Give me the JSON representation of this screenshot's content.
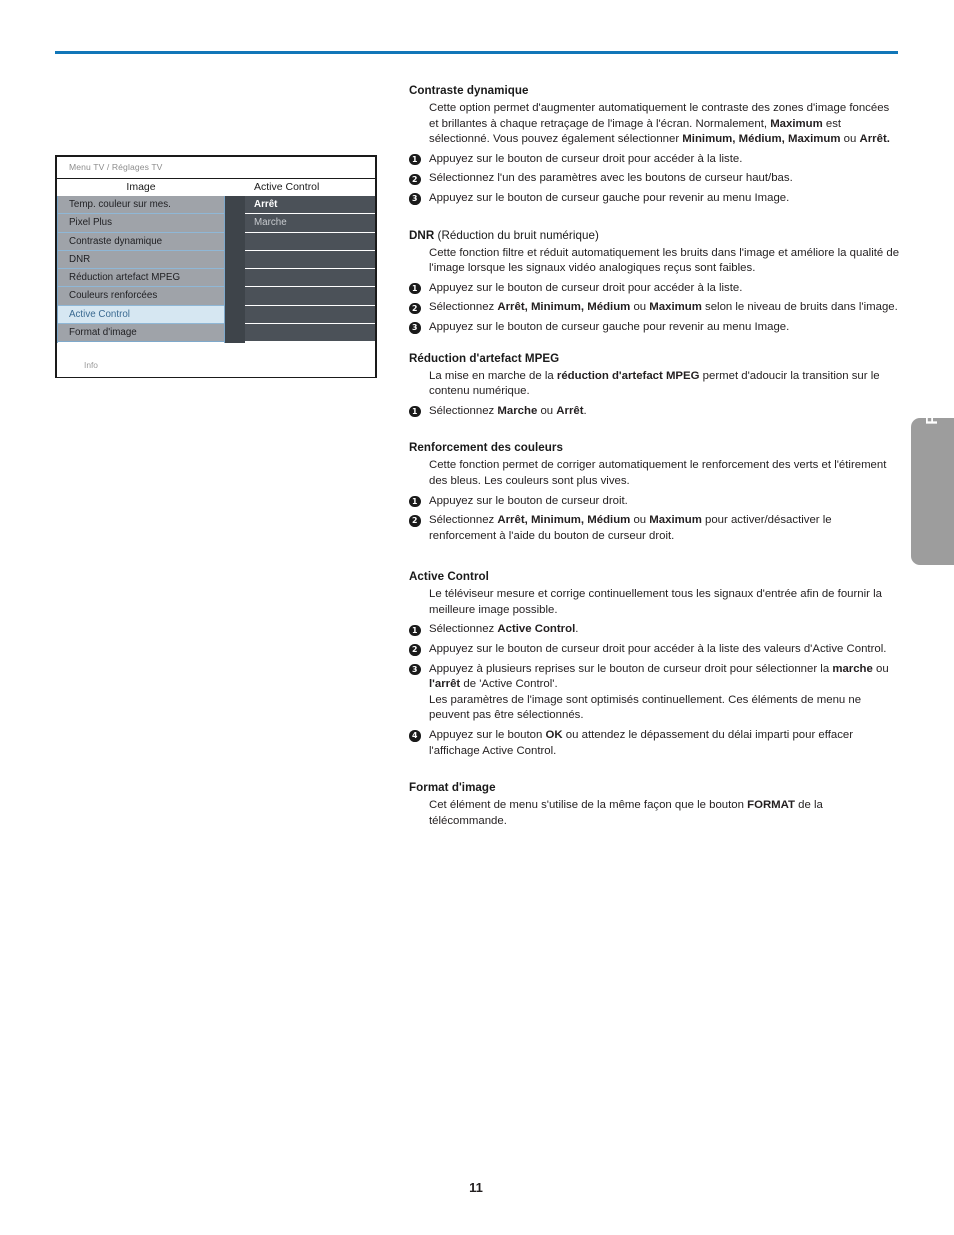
{
  "page": {
    "number": "11",
    "language_tab": "Française",
    "rule_color": "#1176b8"
  },
  "tv_menu": {
    "titlebar": "Menu TV / Réglages TV",
    "left_column_header": "Image",
    "right_column_header": "Active Control",
    "left_items": [
      {
        "label": "Temp. couleur sur mes.",
        "selected": false
      },
      {
        "label": "Pixel Plus",
        "selected": false
      },
      {
        "label": "Contraste dynamique",
        "selected": false
      },
      {
        "label": "DNR",
        "selected": false
      },
      {
        "label": "Réduction artefact MPEG",
        "selected": false
      },
      {
        "label": "Couleurs renforcées",
        "selected": false
      },
      {
        "label": "Active Control",
        "selected": true
      },
      {
        "label": "Format d'image",
        "selected": false
      }
    ],
    "right_items": [
      {
        "label": "Arrêt",
        "current": true
      },
      {
        "label": "Marche",
        "current": false
      },
      {
        "label": "",
        "current": false
      },
      {
        "label": "",
        "current": false
      },
      {
        "label": "",
        "current": false
      },
      {
        "label": "",
        "current": false
      },
      {
        "label": "",
        "current": false
      },
      {
        "label": "",
        "current": false
      }
    ],
    "footer": "Info",
    "colors": {
      "left_item_bg": "#9fa3a9",
      "left_item_selected_bg": "#d6e7f2",
      "right_item_bg": "#4b5158",
      "divider": "#8fb7d6"
    }
  },
  "sections": {
    "contraste": {
      "title": "Contraste dynamique",
      "para1_a": "Cette option permet d'augmenter automatiquement le contraste des zones d'image foncées et brillantes à chaque retraçage de l'image à l'écran. Normalement, ",
      "para1_b": "Maximum",
      "para1_c": " est sélectionné. Vous pouvez également sélectionner ",
      "para1_d": "Minimum, Médium, Maximum",
      "para1_e": " ou ",
      "para1_f": "Arrêt.",
      "step1": "Appuyez sur le bouton de curseur droit pour accéder à la liste.",
      "step2": "Sélectionnez l'un des paramètres avec les boutons de curseur haut/bas.",
      "step3": "Appuyez sur le bouton de curseur gauche pour revenir au menu Image."
    },
    "dnr": {
      "title_bold": "DNR",
      "title_reg": " (Réduction du bruit numérique)",
      "para1": "Cette fonction filtre et réduit automatiquement les bruits dans l'image et améliore la qualité de l'image lorsque les signaux vidéo analogiques reçus sont faibles.",
      "step1": "Appuyez sur le bouton de curseur droit pour accéder à la liste.",
      "step2_a": "Sélectionnez ",
      "step2_b": "Arrêt, Minimum, Médium",
      "step2_c": " ou ",
      "step2_d": "Maximum",
      "step2_e": " selon le niveau de bruits dans l'image.",
      "step3": "Appuyez sur le bouton de curseur gauche pour revenir au menu Image."
    },
    "mpeg": {
      "title": "Réduction d'artefact MPEG",
      "para1_a": "La mise en marche de la ",
      "para1_b": "réduction d'artefact MPEG",
      "para1_c": " permet d'adoucir la transition sur le contenu numérique.",
      "step1_a": "Sélectionnez ",
      "step1_b": "Marche",
      "step1_c": " ou ",
      "step1_d": "Arrêt",
      "step1_e": "."
    },
    "renforcement": {
      "title": "Renforcement des couleurs",
      "para1": "Cette fonction permet de corriger automatiquement le renforcement des verts et l'étirement des bleus. Les couleurs sont plus vives.",
      "step1": "Appuyez sur le bouton de curseur droit.",
      "step2_a": "Sélectionnez ",
      "step2_b": "Arrêt, Minimum, Médium",
      "step2_c": " ou ",
      "step2_d": "Maximum",
      "step2_e": " pour activer/désactiver le renforcement à l'aide du bouton de curseur droit."
    },
    "active_control": {
      "title": "Active Control",
      "para1": "Le téléviseur mesure et corrige continuellement tous les signaux d'entrée afin de fournir la meilleure image possible.",
      "step1_a": "Sélectionnez ",
      "step1_b": "Active Control",
      "step1_c": ".",
      "step2": "Appuyez sur le bouton de curseur droit pour accéder à la liste des valeurs d'Active Control.",
      "step3_a": "Appuyez à plusieurs reprises sur le bouton de curseur droit pour sélectionner la ",
      "step3_b": "marche",
      "step3_c": " ou ",
      "step3_d": "l'arrêt",
      "step3_e": " de 'Active Control'.",
      "step3_f": "Les paramètres de l'image sont optimisés continuellement. Ces éléments de menu ne peuvent pas être sélectionnés.",
      "step4_a": "Appuyez sur le bouton ",
      "step4_b": "OK",
      "step4_c": " ou attendez le dépassement du délai imparti pour effacer l'affichage Active Control."
    },
    "format": {
      "title": "Format d'image",
      "para1_a": "Cet élément de menu s'utilise de la même façon que le bouton ",
      "para1_b": "FORMAT",
      "para1_c": " de la télécommande."
    }
  },
  "bullets": {
    "one": "1",
    "two": "2",
    "three": "3",
    "four": "4"
  }
}
